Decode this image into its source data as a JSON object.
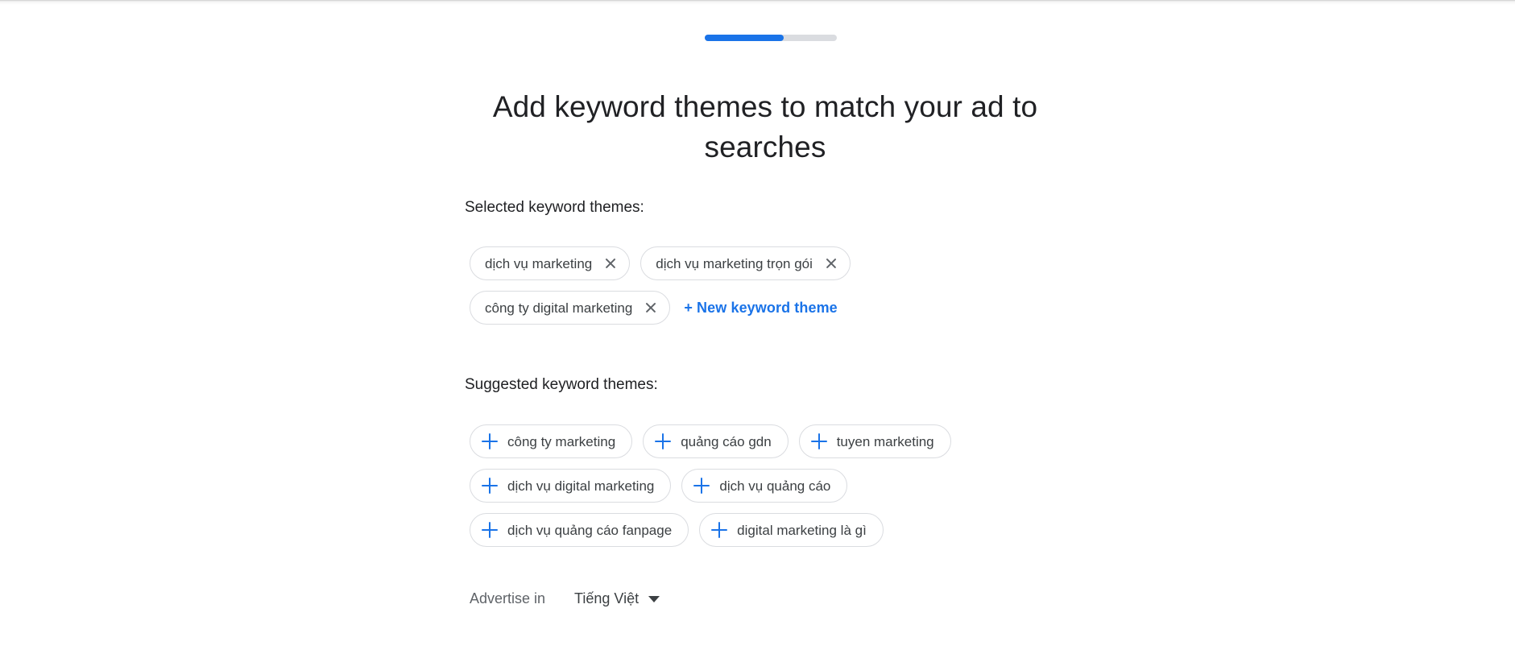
{
  "progress": {
    "percent": 60,
    "fill_color": "#1a73e8",
    "track_color": "#dadce0"
  },
  "title": "Add keyword themes to match your ad to searches",
  "selected_section": {
    "label": "Selected keyword themes:",
    "chips": [
      {
        "text": "dịch vụ marketing",
        "remove_icon": "close-icon"
      },
      {
        "text": "dịch vụ marketing trọn gói",
        "remove_icon": "close-icon"
      },
      {
        "text": "công ty digital marketing",
        "remove_icon": "close-icon"
      }
    ],
    "new_theme_label": "+ New keyword theme",
    "new_theme_color": "#1a73e8"
  },
  "suggested_section": {
    "label": "Suggested keyword themes:",
    "add_icon": "plus-icon",
    "chips": [
      {
        "text": "công ty marketing"
      },
      {
        "text": "quảng cáo gdn"
      },
      {
        "text": "tuyen marketing"
      },
      {
        "text": "dịch vụ digital marketing"
      },
      {
        "text": "dịch vụ quảng cáo"
      },
      {
        "text": "dịch vụ quảng cáo fanpage"
      },
      {
        "text": "digital marketing là gì"
      }
    ]
  },
  "footer": {
    "advertise_label": "Advertise in",
    "language_value": "Tiếng Việt",
    "caret_icon": "chevron-down-icon"
  },
  "colors": {
    "accent": "#1a73e8",
    "text_primary": "#202124",
    "text_secondary": "#5f6368",
    "chip_text": "#3c4043",
    "border": "#dadce0",
    "background": "#ffffff"
  }
}
